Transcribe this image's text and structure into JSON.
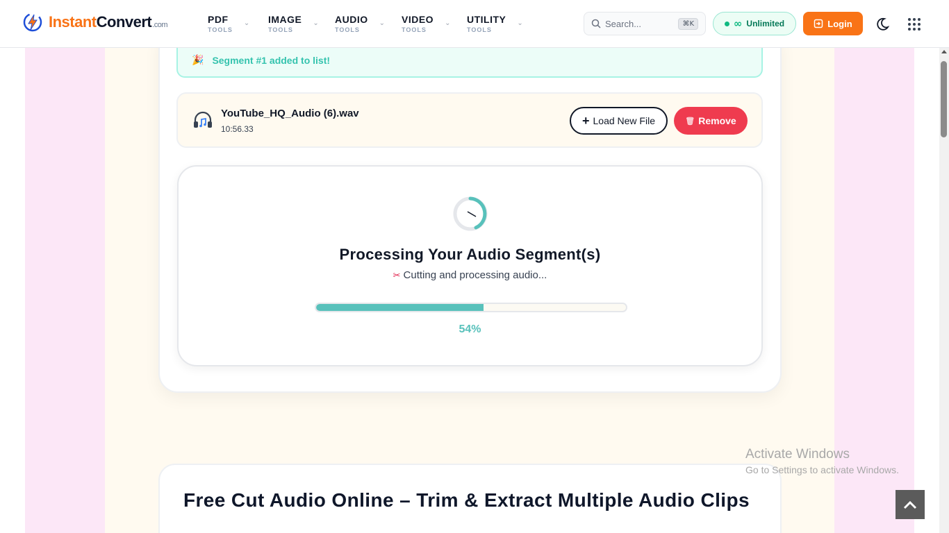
{
  "header": {
    "logo": {
      "word1": "Instant",
      "word2": "Convert",
      "suffix": ".com"
    },
    "nav": [
      {
        "label": "PDF",
        "sub": "TOOLS"
      },
      {
        "label": "IMAGE",
        "sub": "TOOLS"
      },
      {
        "label": "AUDIO",
        "sub": "TOOLS"
      },
      {
        "label": "VIDEO",
        "sub": "TOOLS"
      },
      {
        "label": "UTILITY",
        "sub": "TOOLS"
      }
    ],
    "search": {
      "placeholder": "Search...",
      "shortcut": "⌘K"
    },
    "plan_badge": "Unlimited",
    "login_label": "Login"
  },
  "toast": {
    "message": "Segment #1 added to list!"
  },
  "file": {
    "name": "YouTube_HQ_Audio (6).wav",
    "duration": "10:56.33",
    "load_label": "Load New File",
    "remove_label": "Remove"
  },
  "processing": {
    "title": "Processing Your Audio Segment(s)",
    "status": "Cutting and processing audio...",
    "progress_percent": 54,
    "progress_label": "54%"
  },
  "info": {
    "title": "Free Cut Audio Online – Trim & Extract Multiple Audio Clips"
  },
  "watermark": {
    "line1": "Activate Windows",
    "line2": "Go to Settings to activate Windows."
  },
  "colors": {
    "brand_orange": "#f97316",
    "accent_teal": "#58c1bb",
    "danger_red": "#ef3b4f",
    "success_green": "#10b981"
  }
}
